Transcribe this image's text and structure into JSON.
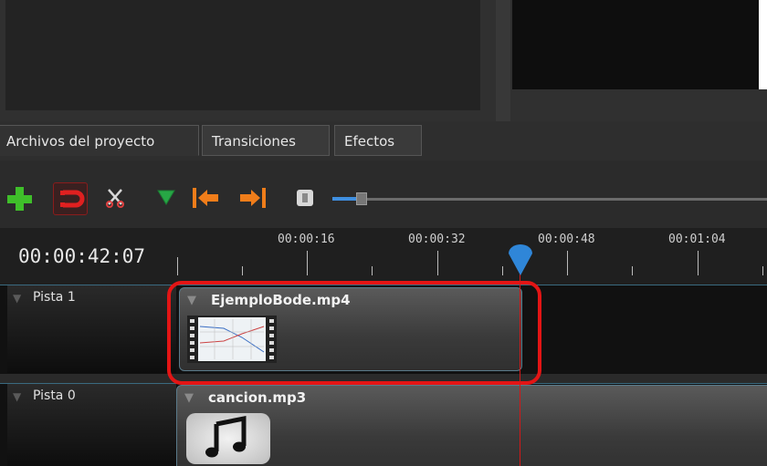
{
  "tabs": [
    {
      "label": "Archivos del proyecto",
      "active": true
    },
    {
      "label": "Transiciones",
      "active": false
    },
    {
      "label": "Efectos",
      "active": false
    }
  ],
  "toolbar": {
    "icons": [
      "add-icon",
      "snap-icon",
      "razor-icon",
      "marker-icon",
      "jump-start-icon",
      "jump-end-icon",
      "center-playhead-icon"
    ],
    "zoom_level": 0.06
  },
  "timeline": {
    "current_time": "00:00:42:07",
    "ruler_labels": [
      "00:00:16",
      "00:00:32",
      "00:00:48",
      "00:01:04"
    ],
    "playhead_time": "00:00:42:07"
  },
  "tracks": [
    {
      "name": "Pista 1",
      "clip": {
        "title": "EjemploBode.mp4",
        "thumbnail": "video-thumbnail"
      }
    },
    {
      "name": "Pista 0",
      "clip": {
        "title": "cancion.mp3",
        "thumbnail": "music-note-icon"
      }
    }
  ],
  "colors": {
    "highlight": "#e31515",
    "playhead": "#2f86d8",
    "add": "#3fbf2a",
    "marker": "#27a745",
    "jump": "#f07d1a",
    "zoom_accent": "#3f8fe0"
  }
}
